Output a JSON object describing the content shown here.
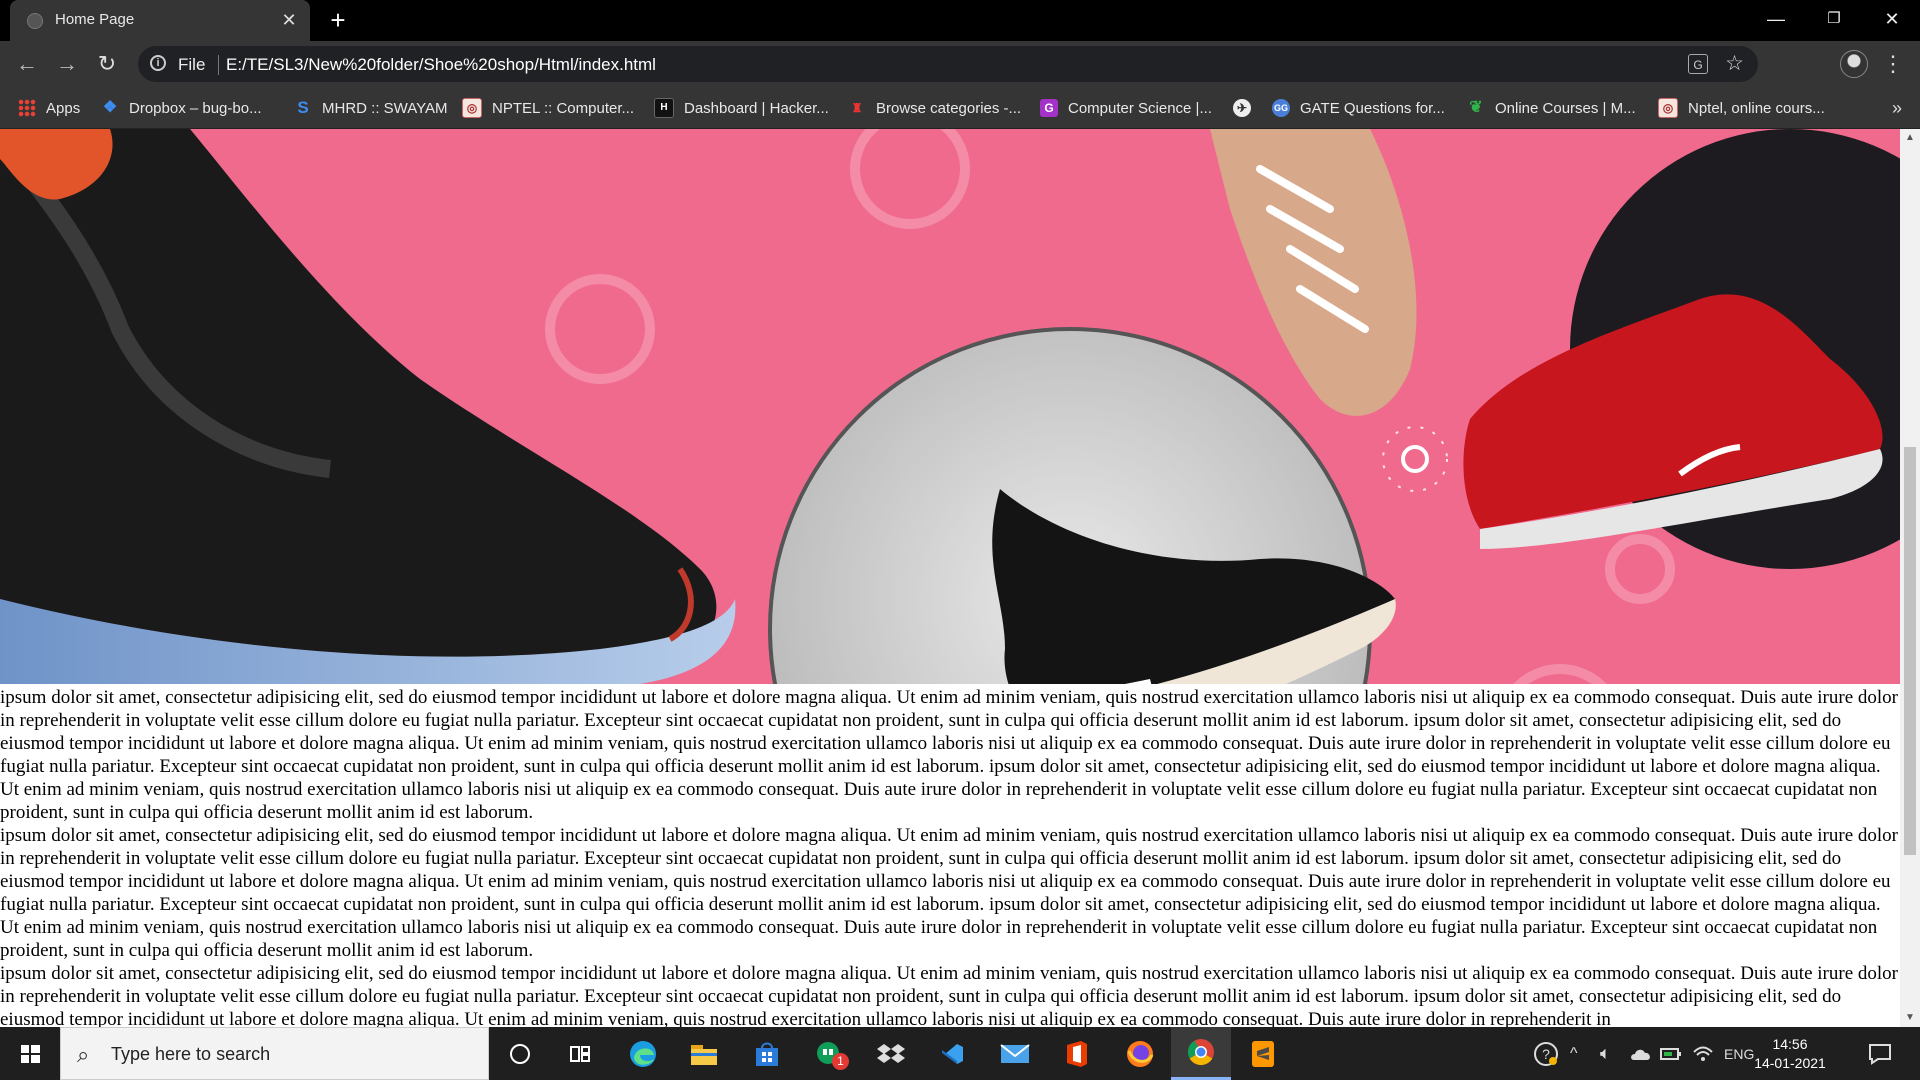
{
  "browser": {
    "tab_title": "Home Page",
    "window_controls": {
      "minimize": "—",
      "maximize": "❐",
      "close": "✕"
    },
    "file_label": "File",
    "url": "E:/TE/SL3/New%20folder/Shoe%20shop/Html/index.html"
  },
  "bookmarks": [
    {
      "label": "Apps",
      "icon": "apps-grid-icon"
    },
    {
      "label": "Dropbox – bug-bo...",
      "icon": "dropbox-icon"
    },
    {
      "label": "MHRD :: SWAYAM",
      "icon": "swayam-icon"
    },
    {
      "label": "NPTEL :: Computer...",
      "icon": "nptel-icon"
    },
    {
      "label": "Dashboard | Hacker...",
      "icon": "hackerrank-icon"
    },
    {
      "label": "Browse categories -...",
      "icon": "browse-icon"
    },
    {
      "label": "Computer Science |...",
      "icon": "g-icon"
    },
    {
      "label": "",
      "icon": "globe-icon"
    },
    {
      "label": "GATE Questions for...",
      "icon": "gate-icon"
    },
    {
      "label": "Online Courses | M...",
      "icon": "leaf-icon"
    },
    {
      "label": "Nptel, online cours...",
      "icon": "nptel-icon"
    }
  ],
  "page": {
    "paragraphs": [
      "ipsum dolor sit amet, consectetur adipisicing elit, sed do eiusmod tempor incididunt ut labore et dolore magna aliqua. Ut enim ad minim veniam, quis nostrud exercitation ullamco laboris nisi ut aliquip ex ea commodo consequat. Duis aute irure dolor in reprehenderit in voluptate velit esse cillum dolore eu fugiat nulla pariatur. Excepteur sint occaecat cupidatat non proident, sunt in culpa qui officia deserunt mollit anim id est laborum. ipsum dolor sit amet, consectetur adipisicing elit, sed do eiusmod tempor incididunt ut labore et dolore magna aliqua. Ut enim ad minim veniam, quis nostrud exercitation ullamco laboris nisi ut aliquip ex ea commodo consequat. Duis aute irure dolor in reprehenderit in voluptate velit esse cillum dolore eu fugiat nulla pariatur. Excepteur sint occaecat cupidatat non proident, sunt in culpa qui officia deserunt mollit anim id est laborum. ipsum dolor sit amet, consectetur adipisicing elit, sed do eiusmod tempor incididunt ut labore et dolore magna aliqua. Ut enim ad minim veniam, quis nostrud exercitation ullamco laboris nisi ut aliquip ex ea commodo consequat. Duis aute irure dolor in reprehenderit in voluptate velit esse cillum dolore eu fugiat nulla pariatur. Excepteur sint occaecat cupidatat non proident, sunt in culpa qui officia deserunt mollit anim id est laborum.",
      "ipsum dolor sit amet, consectetur adipisicing elit, sed do eiusmod tempor incididunt ut labore et dolore magna aliqua. Ut enim ad minim veniam, quis nostrud exercitation ullamco laboris nisi ut aliquip ex ea commodo consequat. Duis aute irure dolor in reprehenderit in voluptate velit esse cillum dolore eu fugiat nulla pariatur. Excepteur sint occaecat cupidatat non proident, sunt in culpa qui officia deserunt mollit anim id est laborum. ipsum dolor sit amet, consectetur adipisicing elit, sed do eiusmod tempor incididunt ut labore et dolore magna aliqua. Ut enim ad minim veniam, quis nostrud exercitation ullamco laboris nisi ut aliquip ex ea commodo consequat. Duis aute irure dolor in reprehenderit in voluptate velit esse cillum dolore eu fugiat nulla pariatur. Excepteur sint occaecat cupidatat non proident, sunt in culpa qui officia deserunt mollit anim id est laborum. ipsum dolor sit amet, consectetur adipisicing elit, sed do eiusmod tempor incididunt ut labore et dolore magna aliqua. Ut enim ad minim veniam, quis nostrud exercitation ullamco laboris nisi ut aliquip ex ea commodo consequat. Duis aute irure dolor in reprehenderit in voluptate velit esse cillum dolore eu fugiat nulla pariatur. Excepteur sint occaecat cupidatat non proident, sunt in culpa qui officia deserunt mollit anim id est laborum.",
      "ipsum dolor sit amet, consectetur adipisicing elit, sed do eiusmod tempor incididunt ut labore et dolore magna aliqua. Ut enim ad minim veniam, quis nostrud exercitation ullamco laboris nisi ut aliquip ex ea commodo consequat. Duis aute irure dolor in reprehenderit in voluptate velit esse cillum dolore eu fugiat nulla pariatur. Excepteur sint occaecat cupidatat non proident, sunt in culpa qui officia deserunt mollit anim id est laborum. ipsum dolor sit amet, consectetur adipisicing elit, sed do eiusmod tempor incididunt ut labore et dolore magna aliqua. Ut enim ad minim veniam, quis nostrud exercitation ullamco laboris nisi ut aliquip ex ea commodo consequat. Duis aute irure dolor in reprehenderit in"
    ]
  },
  "taskbar": {
    "search_placeholder": "Type here to search",
    "apps": [
      "cortana-icon",
      "task-view-icon",
      "edge-icon",
      "file-explorer-icon",
      "store-icon",
      "hangouts-icon",
      "dropbox-icon",
      "vscode-icon",
      "mail-icon",
      "office-icon",
      "firefox-icon",
      "chrome-icon",
      "sublime-icon"
    ],
    "notification_badge": "1",
    "language": "ENG",
    "time": "14:56",
    "date": "14-01-2021"
  },
  "colors": {
    "hero_pink": "#f06a8e",
    "chrome_dark": "#353535",
    "taskbar": "#1f1f1f"
  }
}
